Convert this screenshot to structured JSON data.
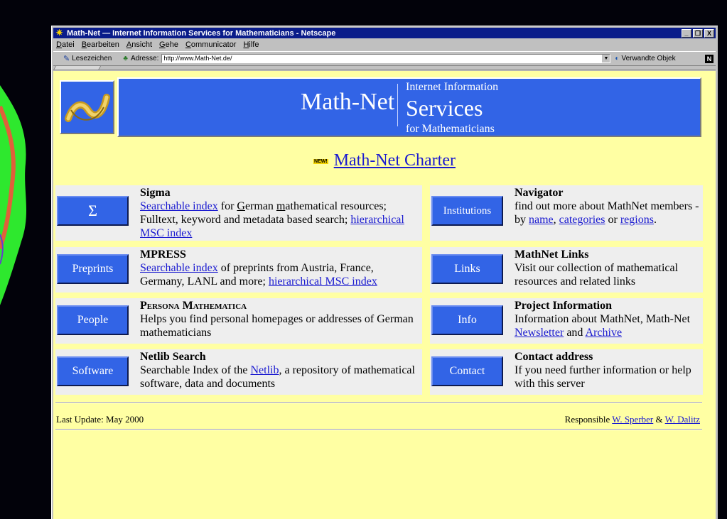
{
  "window": {
    "title": "Math-Net — Internet Information Services for Mathematicians - Netscape",
    "controls": {
      "minimize": "_",
      "restore": "❐",
      "close": "X"
    }
  },
  "menu": [
    "Datei",
    "Bearbeiten",
    "Ansicht",
    "Gehe",
    "Communicator",
    "Hilfe"
  ],
  "toolbar": {
    "bookmarks_label": "Lesezeichen",
    "address_label": "Adresse:",
    "address_value": "http://www.Math-Net.de/",
    "related_label": "Verwandte Objek"
  },
  "header": {
    "brand": "Math-Net",
    "tagline_1": "Internet Information",
    "tagline_2": "Services",
    "tagline_3": "for Mathematicians"
  },
  "charter": {
    "badge": "NEW!",
    "link": "Math-Net Charter"
  },
  "left_cards": [
    {
      "button": "Σ",
      "title": "Sigma"
    },
    {
      "button": "Preprints",
      "title": "MPRESS",
      "link1": "Searchable index",
      "text1": " of preprints from Austria, France, Germany, LANL and more; ",
      "link2": "hierarchical MSC index"
    },
    {
      "button": "People",
      "title": "Persona Mathematica",
      "text": "Helps you find personal homepages or addresses of German mathematicians"
    },
    {
      "button": "Software",
      "title": "Netlib Search",
      "text1": "Searchable Index of the ",
      "link1": "Netlib",
      "text2": ", a repository of mathematical software, data and documents"
    }
  ],
  "sigma": {
    "link1": "Searchable index",
    "text1": " for ",
    "u1": "G",
    "text2": "erman ",
    "u2": "m",
    "text3": "athematical resources; Fulltext, keyword and metadata based search; ",
    "link2": "hierarchical MSC index"
  },
  "right_cards": [
    {
      "button": "Institutions",
      "title": "Navigator",
      "text1": "find out more about MathNet members - by ",
      "link1": "name",
      "text2": ", ",
      "link2": "categories",
      "text3": " or ",
      "link3": "regions",
      "text4": "."
    },
    {
      "button": "Links",
      "title": "MathNet Links",
      "text": "Visit our collection of mathematical resources and related links"
    },
    {
      "button": "Info",
      "title": "Project Information",
      "text1": "Information about MathNet, Math-Net ",
      "link1": "Newsletter",
      "text2": " and ",
      "link2": "Archive"
    },
    {
      "button": "Contact",
      "title": "Contact address",
      "text": "If you need further information or help with this server"
    }
  ],
  "footer": {
    "last_update": "Last Update: May 2000",
    "responsible": "Responsible ",
    "person1": "W. Sperber",
    "amp": " & ",
    "person2": "W. Dalitz"
  }
}
